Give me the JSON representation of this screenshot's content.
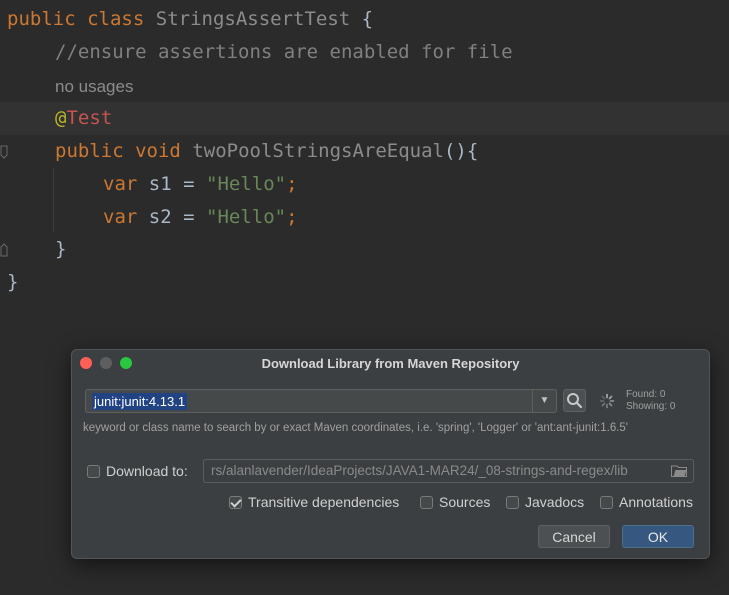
{
  "editor": {
    "class_decl": {
      "kw1": "public",
      "kw2": "class",
      "name": "StringsAssertTest",
      "brace": "{"
    },
    "comment": "//ensure assertions are enabled for file",
    "usages": "no usages",
    "annotation": {
      "at": "@",
      "name": "Test"
    },
    "method_decl": {
      "kw1": "public",
      "kw2": "void",
      "name": "twoPoolStringsAreEqual",
      "rest": "(){"
    },
    "var1": {
      "kw": "var",
      "name": "s1",
      "eq": "=",
      "value": "\"Hello\"",
      "semi": ";"
    },
    "var2": {
      "kw": "var",
      "name": "s2",
      "eq": "=",
      "value": "\"Hello\"",
      "semi": ";"
    },
    "method_close": "}",
    "class_close": "}"
  },
  "dialog": {
    "title": "Download Library from Maven Repository",
    "search_value": "junit:junit:4.13.1",
    "found_label": "Found: 0",
    "showing_label": "Showing: 0",
    "hint": "keyword or class name to search by or exact Maven coordinates, i.e. 'spring', 'Logger' or 'ant:ant-junit:1.6.5'",
    "download_to": {
      "label": "Download to:",
      "checked": false,
      "path": "rs/alanlavender/IdeaProjects/JAVA1-MAR24/_08-strings-and-regex/lib"
    },
    "options": [
      {
        "label": "Transitive dependencies",
        "checked": true
      },
      {
        "label": "Sources",
        "checked": false
      },
      {
        "label": "Javadocs",
        "checked": false
      },
      {
        "label": "Annotations",
        "checked": false
      }
    ],
    "cancel_label": "Cancel",
    "ok_label": "OK"
  },
  "colors": {
    "editor_bg": "#2b2b2b",
    "keyword": "#cc7832",
    "string": "#6a8759",
    "comment": "#808080",
    "annotation": "#bbb529",
    "selection": "#214283",
    "ok_button": "#365880"
  },
  "icons": [
    "search-icon",
    "dropdown-arrow-icon",
    "loading-spinner-icon",
    "folder-icon"
  ]
}
